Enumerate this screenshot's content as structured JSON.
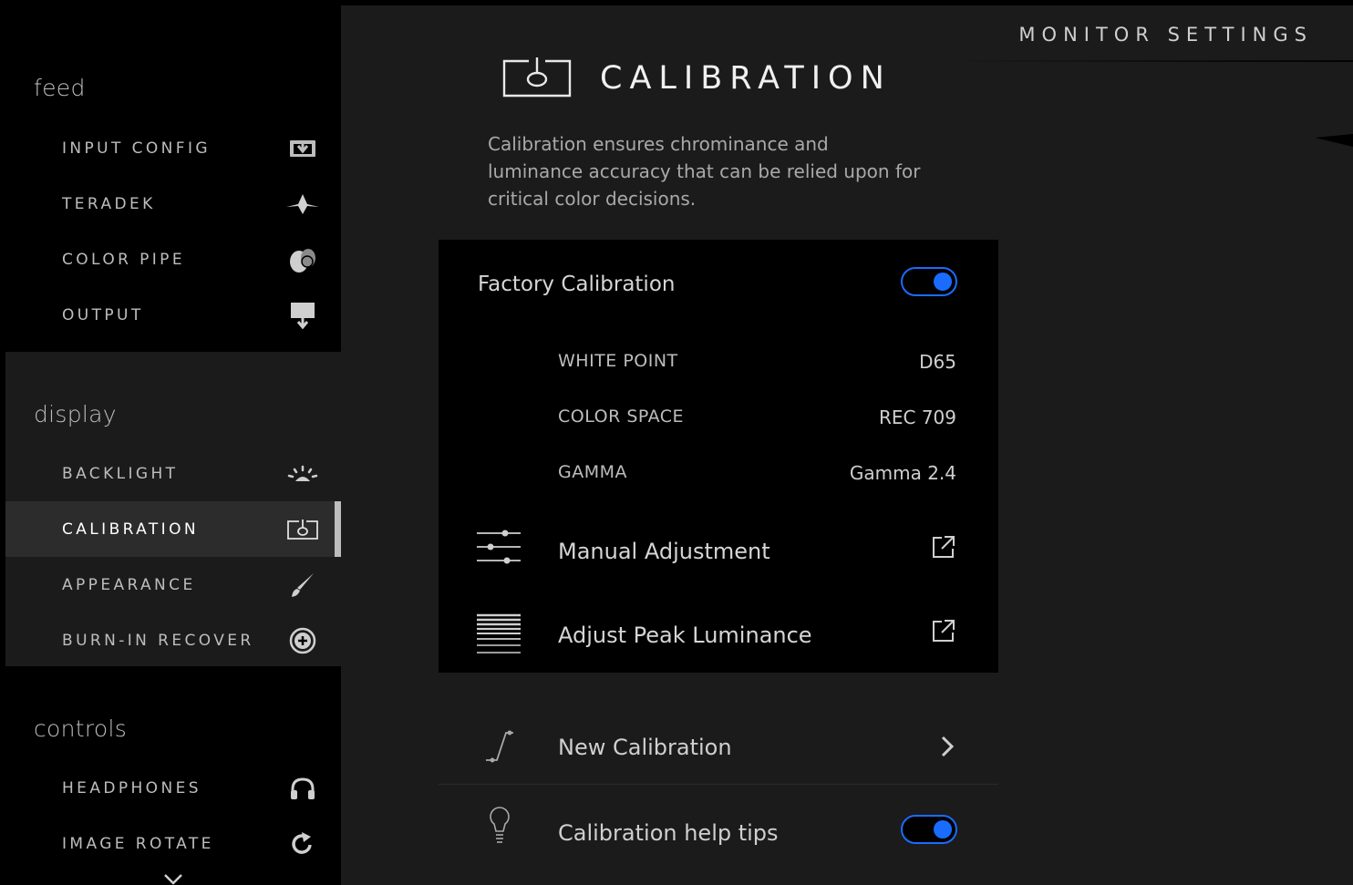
{
  "header": {
    "title": "MONITOR SETTINGS"
  },
  "sidebar": {
    "groups": [
      {
        "title": "feed",
        "items": [
          {
            "label": "INPUT CONFIG",
            "icon": "input-config-icon"
          },
          {
            "label": "TERADEK",
            "icon": "teradek-icon"
          },
          {
            "label": "COLOR PIPE",
            "icon": "color-pipe-icon"
          },
          {
            "label": "OUTPUT",
            "icon": "output-icon"
          }
        ]
      },
      {
        "title": "display",
        "items": [
          {
            "label": "BACKLIGHT",
            "icon": "backlight-icon"
          },
          {
            "label": "CALIBRATION",
            "icon": "calibration-icon",
            "active": true
          },
          {
            "label": "APPEARANCE",
            "icon": "brush-icon"
          },
          {
            "label": "BURN-IN RECOVER",
            "icon": "plus-circle-icon"
          }
        ]
      },
      {
        "title": "controls",
        "items": [
          {
            "label": "HEADPHONES",
            "icon": "headphones-icon"
          },
          {
            "label": "IMAGE ROTATE",
            "icon": "rotate-icon"
          }
        ]
      }
    ]
  },
  "main": {
    "title": "CALIBRATION",
    "description": "Calibration ensures chrominance and luminance accuracy that can be relied upon for critical color decisions.",
    "panel": {
      "factory_label": "Factory Calibration",
      "factory_enabled": true,
      "settings": [
        {
          "label": "WHITE POINT",
          "value": "D65"
        },
        {
          "label": "COLOR SPACE",
          "value": "REC 709"
        },
        {
          "label": "GAMMA",
          "value": "Gamma 2.4"
        }
      ],
      "links": [
        {
          "label": "Manual Adjustment",
          "icon": "sliders-icon"
        },
        {
          "label": "Adjust Peak Luminance",
          "icon": "luminance-lines-icon"
        }
      ]
    },
    "new_calibration": {
      "label": "New Calibration"
    },
    "help_tips": {
      "label": "Calibration help tips",
      "enabled": true
    }
  },
  "colors": {
    "accent": "#1a6cff",
    "background": "#1b1b1b",
    "panel": "#000000"
  }
}
